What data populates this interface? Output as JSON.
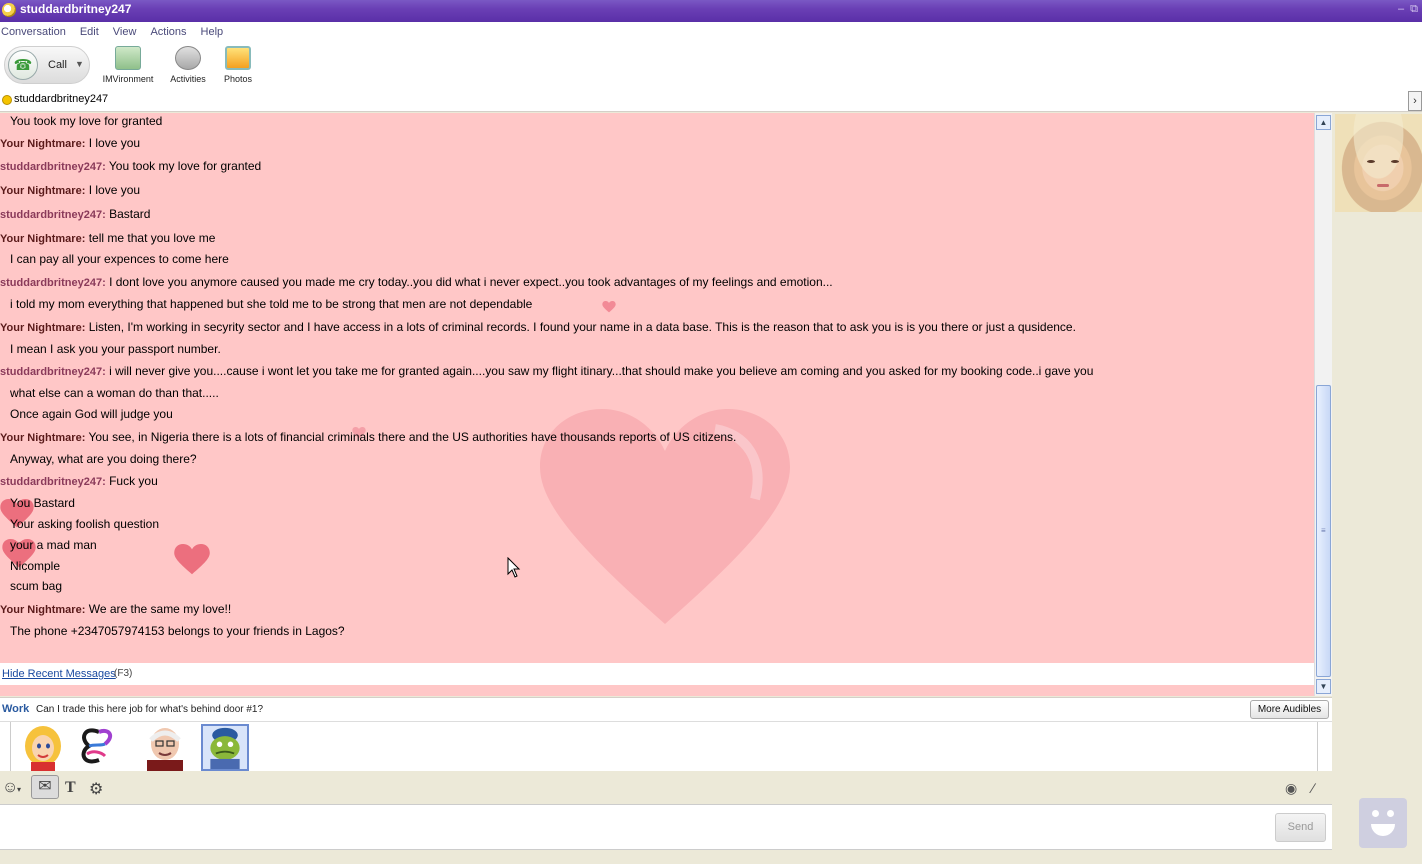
{
  "window": {
    "title": "studdardbritney247"
  },
  "menu": {
    "items": [
      "Conversation",
      "Edit",
      "View",
      "Actions",
      "Help"
    ]
  },
  "toolbar": {
    "call_label": "Call",
    "imvironment_label": "IMVironment",
    "activities_label": "Activities",
    "photos_label": "Photos"
  },
  "contact": {
    "name": "studdardbritney247"
  },
  "conversation": [
    {
      "sender": "",
      "text": "You took my love for granted"
    },
    {
      "sender": "Your Nightmare:",
      "who": "you",
      "text": "I love you"
    },
    {
      "sender": "studdardbritney247:",
      "who": "her",
      "text": "You took my love for granted"
    },
    {
      "sender": "Your Nightmare:",
      "who": "you",
      "text": "I love you"
    },
    {
      "sender": "studdardbritney247:",
      "who": "her",
      "text": "Bastard"
    },
    {
      "sender": "Your Nightmare:",
      "who": "you",
      "text": "tell me that you love me"
    },
    {
      "sender": "",
      "text": "I can pay all your expences to come here"
    },
    {
      "sender": "studdardbritney247:",
      "who": "her",
      "text": "I dont love you anymore caused you made me cry today..you did what i never expect..you took advantages of my feelings and emotion..."
    },
    {
      "sender": "",
      "text": "i told my mom everything that happened but she told me to be strong that men are not dependable"
    },
    {
      "sender": "Your Nightmare:",
      "who": "you",
      "text": "Listen, I'm working in secyrity sector and I have access in a lots of criminal records. I found your name in a data base. This is the reason that to ask you is is you there or just a qusidence."
    },
    {
      "sender": "",
      "text": "I mean I ask you your passport number."
    },
    {
      "sender": "studdardbritney247:",
      "who": "her",
      "text": "i will never give you....cause i wont let you take me for granted again....you saw my flight itinary...that should make you believe am coming and you asked for my booking code..i gave you"
    },
    {
      "sender": "",
      "text": "what else can a woman do than that....."
    },
    {
      "sender": "",
      "text": "Once again God will judge you"
    },
    {
      "sender": "Your Nightmare:",
      "who": "you",
      "text": "You see, in Nigeria there is a lots of financial criminals there and the US authorities have thousands reports of US citizens."
    },
    {
      "sender": "",
      "text": "Anyway, what are you doing there?"
    },
    {
      "sender": "studdardbritney247:",
      "who": "her",
      "text": "Fuck you"
    },
    {
      "sender": "",
      "text": "You Bastard"
    },
    {
      "sender": "",
      "text": "Your asking foolish question"
    },
    {
      "sender": "",
      "text": "your a mad man"
    },
    {
      "sender": "",
      "text": "Nicomple"
    },
    {
      "sender": "",
      "text": "scum bag"
    },
    {
      "sender": "Your Nightmare:",
      "who": "you",
      "text": "We are the same my love!!"
    },
    {
      "sender": "",
      "text": "The phone +2347057974153 belongs to your friends in Lagos?"
    }
  ],
  "recent": {
    "hide_link": "Hide Recent Messages",
    "hotkey": "(F3)"
  },
  "audibles": {
    "category": "Work",
    "caption": "Can I trade this here job for what's behind door #1?",
    "more_label": "More Audibles",
    "items": [
      "blonde-woman-audible",
      "butterfly-audible",
      "old-man-audible",
      "frog-worker-audible"
    ],
    "selected_index": 3
  },
  "input": {
    "send_label": "Send",
    "value": ""
  },
  "colors": {
    "chat_bg": "#ffc7c7",
    "title_bar": "#6a3fb5",
    "sender_you": "#5a1a1a",
    "sender_her": "#8a3a5a",
    "link": "#1a4aa0"
  }
}
